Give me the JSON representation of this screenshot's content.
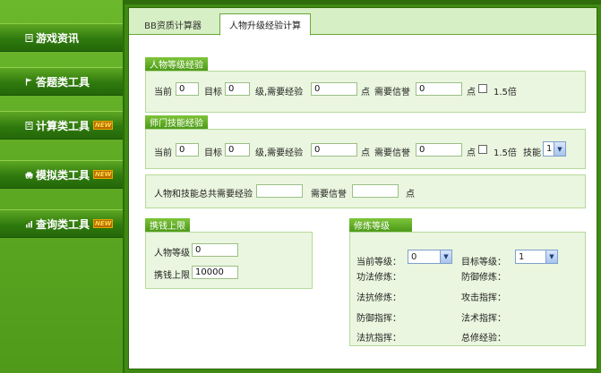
{
  "nav": [
    {
      "label": "游戏资讯",
      "icon": "document-icon",
      "new": ""
    },
    {
      "label": "答题类工具",
      "icon": "flag-icon",
      "new": ""
    },
    {
      "label": "计算类工具",
      "icon": "calculator-icon",
      "new": "NEW"
    },
    {
      "label": "模拟类工具",
      "icon": "car-icon",
      "new": "NEW"
    },
    {
      "label": "查询类工具",
      "icon": "chart-icon",
      "new": "NEW"
    }
  ],
  "tabs": {
    "t1": "BB资质计算器",
    "t2": "人物升级经验计算"
  },
  "char_level": {
    "title": "人物等级经验",
    "current_label": "当前",
    "current_value": "0",
    "target_label": "目标",
    "target_value": "0",
    "exp_label": "级,需要经验",
    "exp_value": "0",
    "unit1": "点",
    "credit_label": "需要信誉",
    "credit_value": "0",
    "unit2": "点",
    "multiplier": "1.5倍"
  },
  "sect_skill": {
    "title": "师门技能经验",
    "current_label": "当前",
    "current_value": "0",
    "target_label": "目标",
    "target_value": "0",
    "exp_label": "级,需要经验",
    "exp_value": "0",
    "unit1": "点",
    "credit_label": "需要信誉",
    "credit_value": "0",
    "unit2": "点",
    "multiplier": "1.5倍",
    "skill_label": "技能",
    "skill_value": "1"
  },
  "total": {
    "exp_label": "人物和技能总共需要经验",
    "exp_value": "",
    "credit_label": "需要信誉",
    "credit_value": "",
    "unit": "点"
  },
  "carry": {
    "title": "携钱上限",
    "level_label": "人物等级",
    "level_value": "0",
    "limit_label": "携钱上限",
    "limit_value": "10000"
  },
  "cultivation": {
    "title": "修炼等级",
    "current_label": "当前等级：",
    "current_value": "0",
    "target_label": "目标等级：",
    "target_value": "1",
    "fields": {
      "f1": "功法修炼：",
      "f2": "防御修炼：",
      "f3": "法抗修炼：",
      "f4": "攻击指挥：",
      "f5": "防御指挥：",
      "f6": "法术指挥：",
      "f7": "法抗指挥：",
      "f8": "总修经验："
    }
  }
}
